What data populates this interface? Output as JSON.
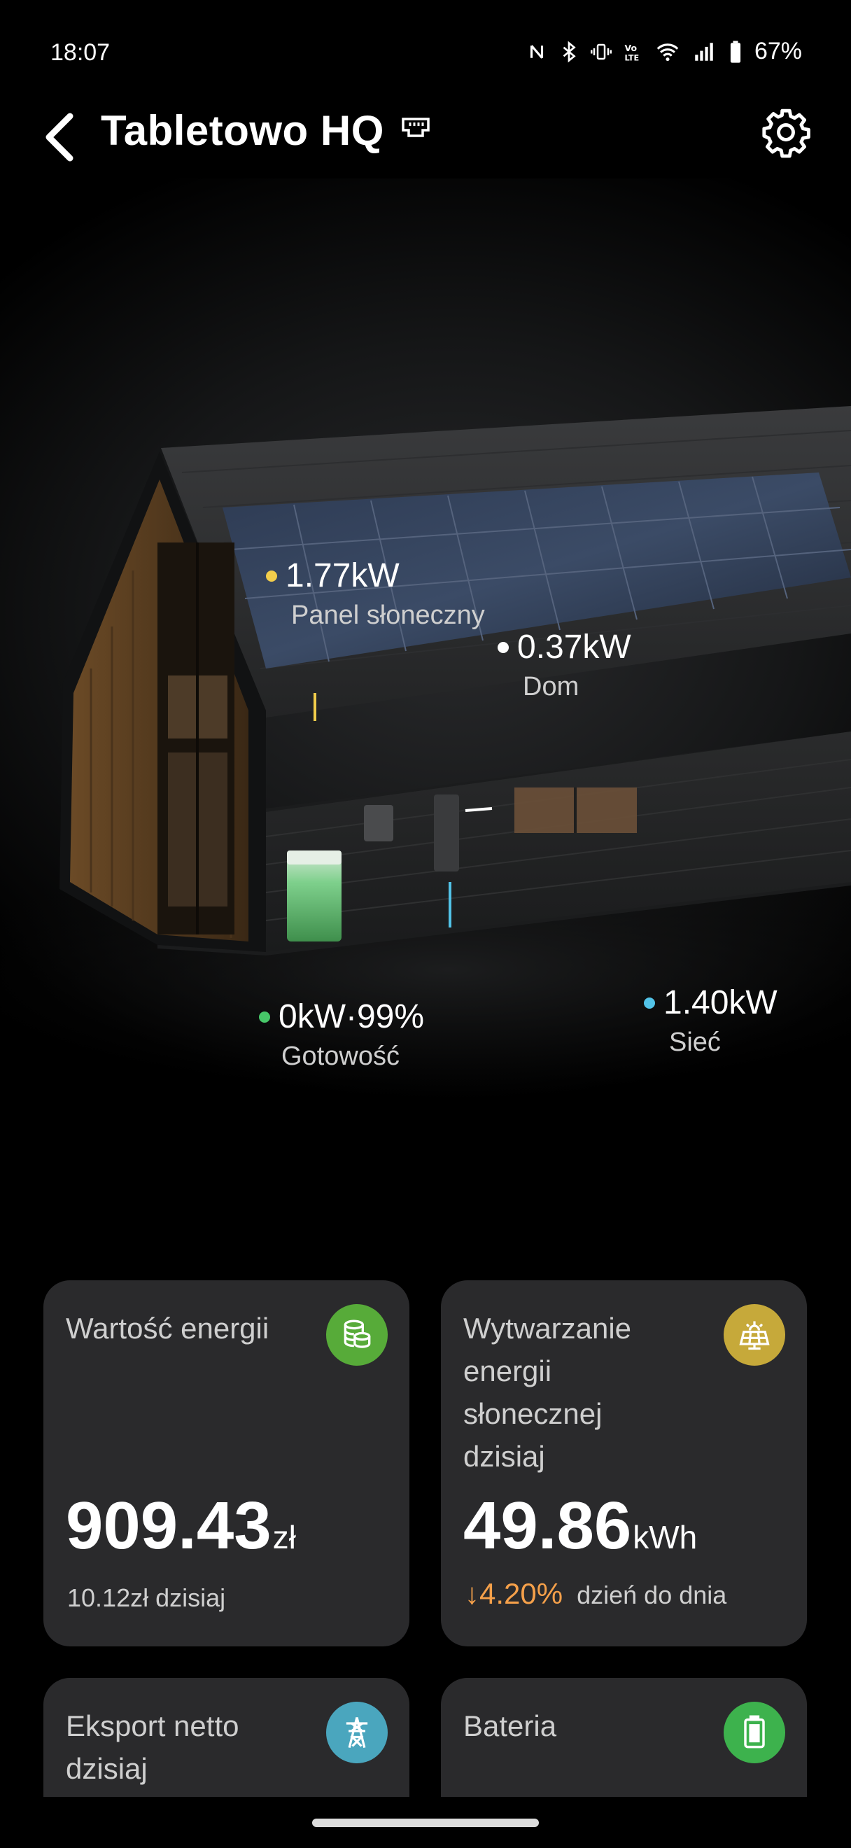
{
  "status_bar": {
    "time": "18:07",
    "battery": "67%"
  },
  "header": {
    "title": "Tabletowo HQ"
  },
  "hero": {
    "solar": {
      "value": "1.77kW",
      "label": "Panel słoneczny",
      "color": "#f2cd4b"
    },
    "home": {
      "value": "0.37kW",
      "label": "Dom",
      "color": "#ffffff"
    },
    "battery": {
      "value": "0kW·99%",
      "label": "Gotowość",
      "color": "#47c769"
    },
    "grid": {
      "value": "1.40kW",
      "label": "Sieć",
      "color": "#52c3e8"
    }
  },
  "cards": {
    "energy_value": {
      "title": "Wartość energii",
      "value": "909.43",
      "unit": "zł",
      "sub": "10.12zł dzisiaj",
      "icon": "coins-icon",
      "icon_color": "#57ab39"
    },
    "solar_today": {
      "title_lines": [
        "Wytwarzanie",
        "energii",
        "słonecznej",
        "dzisiaj"
      ],
      "value": "49.86",
      "unit": "kWh",
      "delta": "↓4.20%",
      "delta_label": "dzień do dnia",
      "icon": "solar-panel-icon",
      "icon_color": "#c6a93a"
    },
    "net_export": {
      "title_lines": [
        "Eksport netto",
        "dzisiaj"
      ],
      "icon": "power-tower-icon",
      "icon_color": "#4aa6be"
    },
    "battery": {
      "title": "Bateria",
      "icon": "battery-icon",
      "icon_color": "#3db24d"
    }
  }
}
